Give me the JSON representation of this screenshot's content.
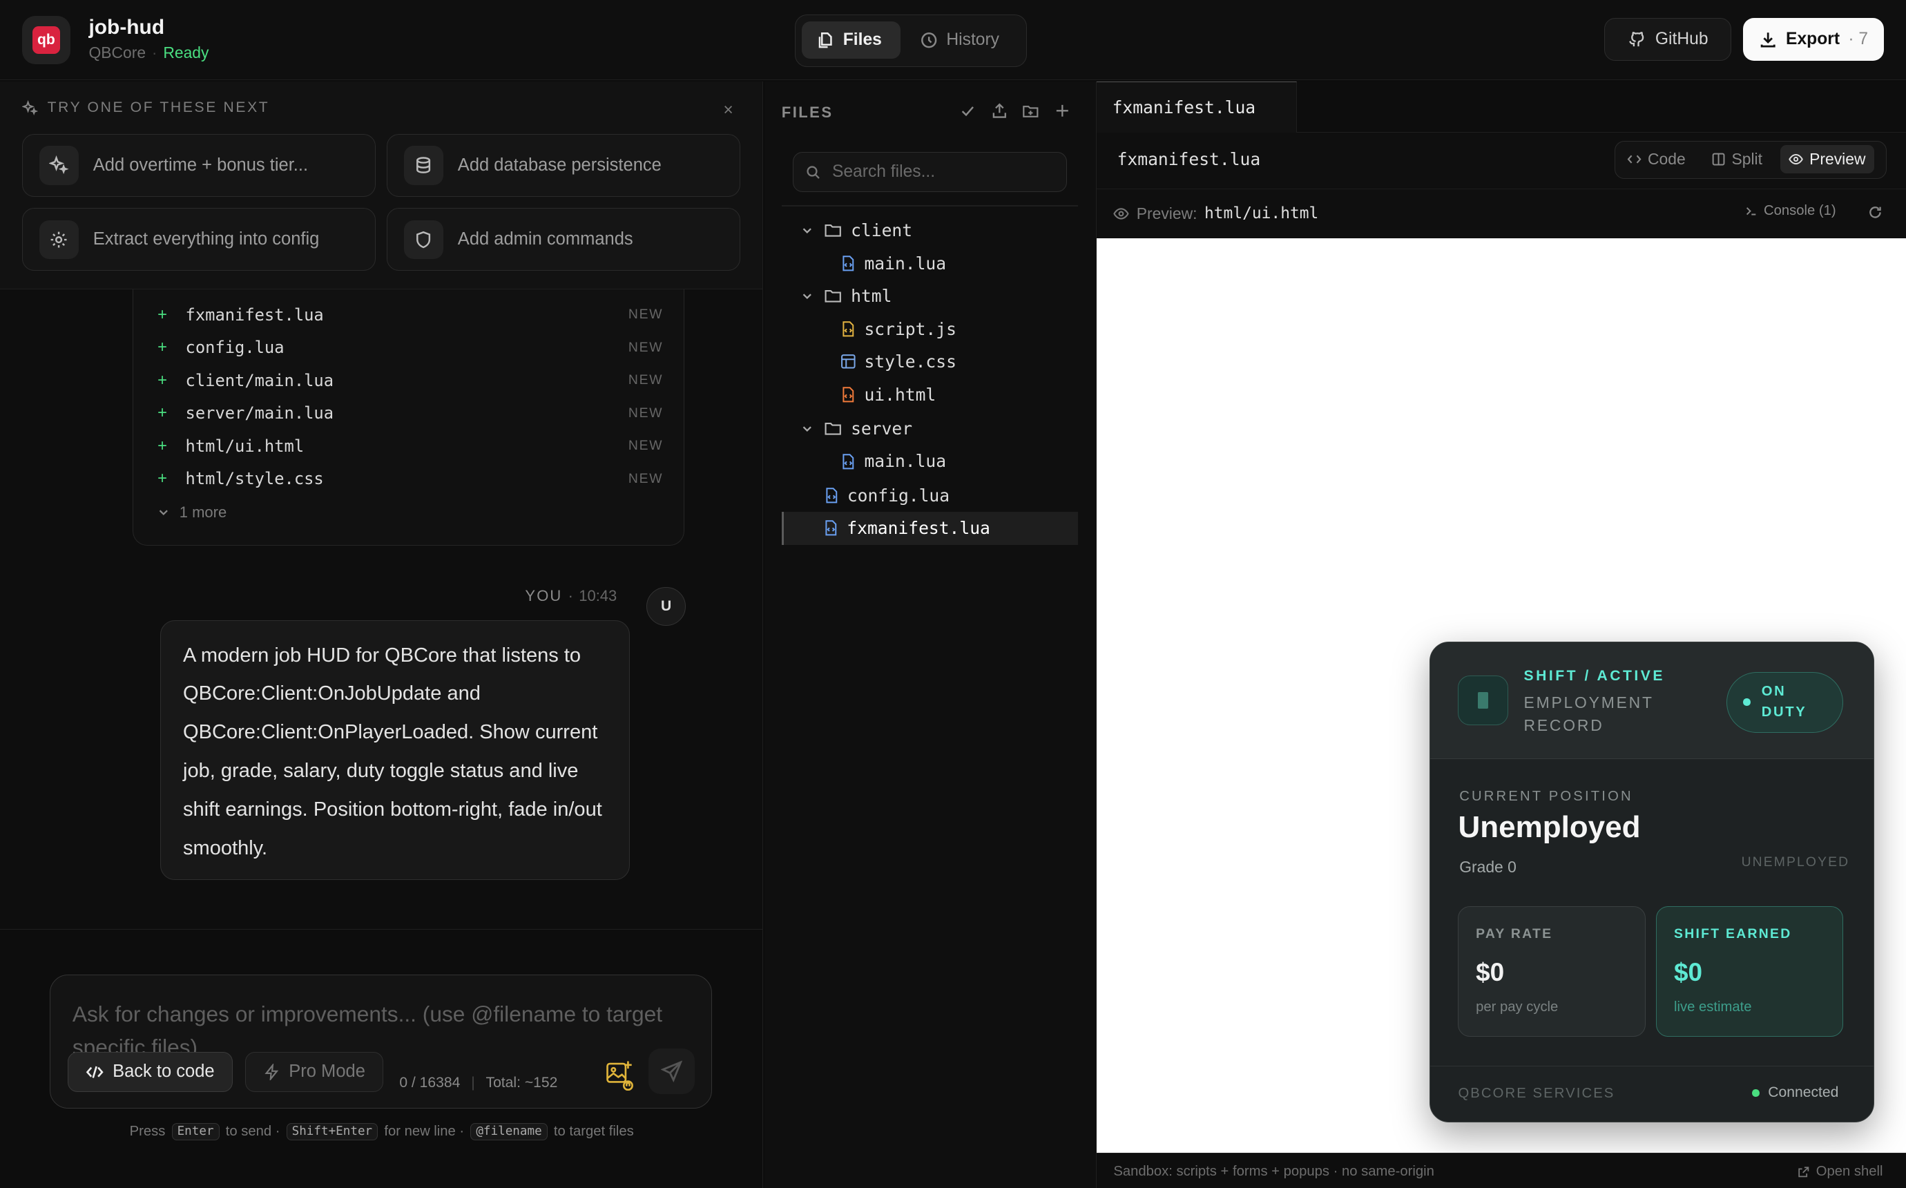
{
  "header": {
    "logo_text": "qb",
    "app_name": "job-hud",
    "framework": "QBCore",
    "status": "Ready",
    "tabs": [
      {
        "label": "Files"
      },
      {
        "label": "History"
      }
    ],
    "github_label": "GitHub",
    "export_label": "Export",
    "export_count": "· 7"
  },
  "suggestions": {
    "title": "TRY ONE OF THESE NEXT",
    "close": "×",
    "items": [
      {
        "label": "Add overtime + bonus tier...",
        "icon": "sparkles-icon"
      },
      {
        "label": "Add database persistence",
        "icon": "database-icon"
      },
      {
        "label": "Extract everything into config",
        "icon": "gear-icon"
      },
      {
        "label": "Add admin commands",
        "icon": "shield-icon"
      }
    ]
  },
  "created_files": {
    "badge": "NEW",
    "items": [
      {
        "path": "fxmanifest.lua"
      },
      {
        "path": "config.lua"
      },
      {
        "path": "client/main.lua"
      },
      {
        "path": "server/main.lua"
      },
      {
        "path": "html/ui.html"
      },
      {
        "path": "html/style.css"
      }
    ],
    "more": "1 more"
  },
  "message": {
    "author": "YOU",
    "time": "10:43",
    "avatar": "U",
    "text": "A modern job HUD for QBCore that listens to QBCore:Client:OnJobUpdate and QBCore:Client:OnPlayerLoaded. Show current job, grade, salary, duty toggle status and live shift earnings. Position bottom-right, fade in/out smoothly."
  },
  "composer": {
    "placeholder": "Ask for changes or improvements... (use @filename to target specific files)",
    "back_to_code": "Back to code",
    "pro_mode": "Pro Mode",
    "char_count": "0 / 16384",
    "total": "Total: ~152",
    "hint": {
      "press": "Press",
      "enter": "Enter",
      "to_send": "to send ·",
      "shift_enter": "Shift+Enter",
      "new_line": "for new line ·",
      "filename": "@filename",
      "target": "to target files"
    }
  },
  "files_panel": {
    "title": "FILES",
    "search_placeholder": "Search files...",
    "tree": [
      {
        "name": "client",
        "type": "folder"
      },
      {
        "name": "main.lua",
        "type": "lua"
      },
      {
        "name": "html",
        "type": "folder"
      },
      {
        "name": "script.js",
        "type": "js"
      },
      {
        "name": "style.css",
        "type": "css"
      },
      {
        "name": "ui.html",
        "type": "html"
      },
      {
        "name": "server",
        "type": "folder"
      },
      {
        "name": "main.lua",
        "type": "lua"
      },
      {
        "name": "config.lua",
        "type": "lua"
      },
      {
        "name": "fxmanifest.lua",
        "type": "lua",
        "selected": true
      }
    ]
  },
  "editor": {
    "tab": "fxmanifest.lua",
    "breadcrumb": "fxmanifest.lua",
    "views": [
      {
        "label": "Code"
      },
      {
        "label": "Split"
      },
      {
        "label": "Preview"
      }
    ],
    "preview_label": "Preview:",
    "preview_path": "html/ui.html",
    "console": "Console (1)",
    "sandbox": "Sandbox: scripts + forms + popups · no same-origin",
    "open_shell": "Open shell"
  },
  "hud": {
    "kicker": "SHIFT / ACTIVE",
    "record": "EMPLOYMENT RECORD",
    "duty": "ON DUTY",
    "position_label": "CURRENT POSITION",
    "job": "Unemployed",
    "grade": "Grade 0",
    "job_tag": "UNEMPLOYED",
    "pay_label": "PAY RATE",
    "pay_value": "$0",
    "pay_sub": "per pay cycle",
    "earned_label": "SHIFT EARNED",
    "earned_value": "$0",
    "earned_sub": "live estimate",
    "services": "QBCORE SERVICES",
    "connection": "Connected",
    "accent": "#5eead4"
  }
}
